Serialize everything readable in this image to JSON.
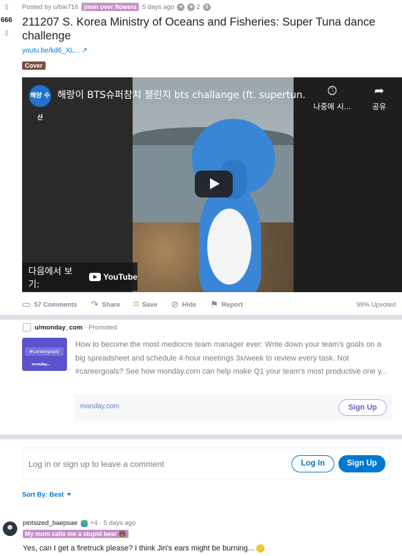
{
  "post": {
    "score": "666",
    "meta": {
      "posted_by": "Posted by u/bie716",
      "flair": "jimin over flowers",
      "time": "5 days ago",
      "award_count": "2"
    },
    "title": "211207 S. Korea Ministry of Oceans and Fisheries: Super Tuna dance challenge",
    "link": "youtu.be/kd6_XL...",
    "tag": "Cover",
    "video": {
      "channel_logo_text": "해양\n수산",
      "title": "해랑이 BTS슈퍼참치 챌린지 bts challange (ft. supertun...",
      "watch_later_label": "나중에 시...",
      "share_label": "공유",
      "watch_on_label": "다음에서 보기:",
      "youtube_label": "YouTube"
    },
    "actions": {
      "comments": "57 Comments",
      "share": "Share",
      "save": "Save",
      "hide": "Hide",
      "report": "Report"
    },
    "upvoted": "99% Upvoted"
  },
  "promoted": {
    "user": "u/monday_com",
    "label": "· Promoted",
    "thumb_chip": "#careergoals",
    "thumb_brand": "monday...",
    "text": "How to become the most mediocre team manager ever: Write down your team's goals on a big spreadsheet and schedule 4-hour meetings 3x/week to review every task. Not #careergoals? See how monday.com can help make Q1 your team's most productive one y...",
    "domain": "monday.com",
    "signup": "Sign Up"
  },
  "comments": {
    "login_prompt": "Log in or sign up to leave a comment",
    "login_button": "Log In",
    "signup_button": "Sign Up",
    "sort": "Sort By: Best",
    "first": {
      "user": "pintsized_baepsae",
      "awards": "+4",
      "time": "· 5 days ago",
      "flair": "My mom calls me a stupid bear 🐻",
      "text": "Yes, can I get a firetruck please? I think Jin's ears might be burning..."
    }
  },
  "colors": {
    "brand_blue": "#0079d3",
    "flair": "#c490c8",
    "cover": "#7c4e3c",
    "separator": "#dae0e6"
  }
}
